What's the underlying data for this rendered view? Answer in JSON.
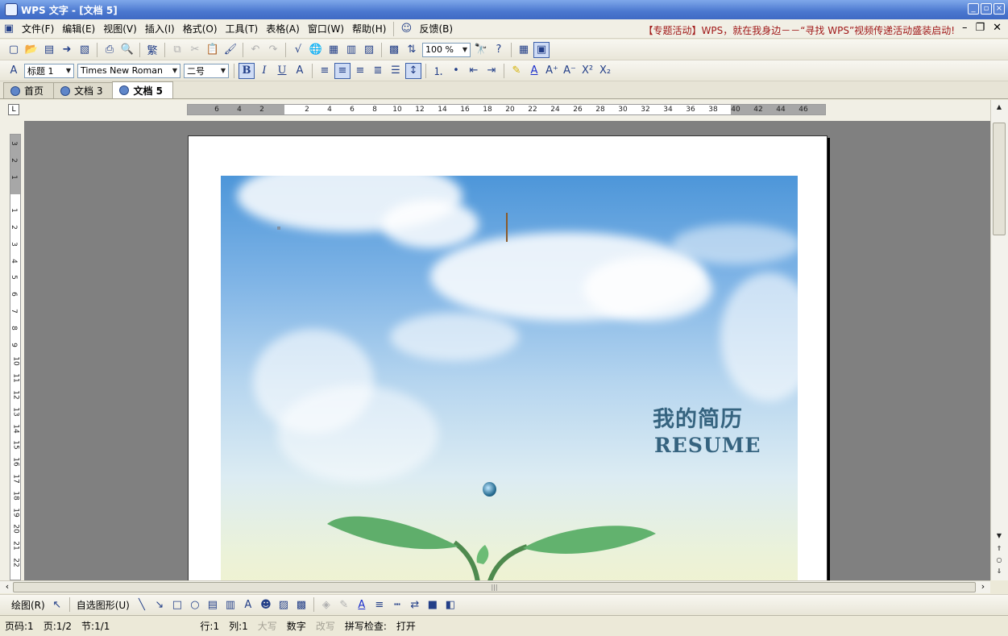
{
  "title": "WPS 文字 - [文档 5]",
  "menu": [
    "文件(F)",
    "编辑(E)",
    "视图(V)",
    "插入(I)",
    "格式(O)",
    "工具(T)",
    "表格(A)",
    "窗口(W)",
    "帮助(H)"
  ],
  "feedback": "反馈(B)",
  "promo": "【专题活动】WPS，就在我身边－－“寻找 WPS”视频传递活动盛装启动!",
  "toolbar1": {
    "zoom": "100 %",
    "trad": "繁"
  },
  "toolbar2": {
    "style": "标题 1",
    "font": "Times New Roman",
    "size": "二号",
    "bold": "B",
    "italic": "I",
    "underline": "U"
  },
  "tabs": [
    {
      "label": "首页"
    },
    {
      "label": "文档 3"
    },
    {
      "label": "文档 5"
    }
  ],
  "hruler_ticks": [
    "6",
    "4",
    "2",
    "2",
    "4",
    "6",
    "8",
    "10",
    "12",
    "14",
    "16",
    "18",
    "20",
    "22",
    "24",
    "26",
    "28",
    "30",
    "32",
    "34",
    "36",
    "38",
    "40",
    "42",
    "44",
    "46"
  ],
  "vruler_ticks": [
    "3",
    "2",
    "1",
    "1",
    "2",
    "3",
    "4",
    "5",
    "6",
    "7",
    "8",
    "9",
    "10",
    "11",
    "12",
    "13",
    "14",
    "15",
    "16",
    "17",
    "18",
    "19",
    "20",
    "21",
    "22"
  ],
  "cover": {
    "title_cn": "我的简历",
    "title_en": "RESUME"
  },
  "drawbar": {
    "draw": "绘图(R)",
    "autoshape": "自选图形(U)"
  },
  "status": {
    "page": "页码:1",
    "pages": "页:1/2",
    "section": "节:1/1",
    "row": "行:1",
    "col": "列:1",
    "caps": "大写",
    "num": "数字",
    "ovr": "改写",
    "spell_label": "拼写检查:",
    "spell_value": "打开"
  }
}
